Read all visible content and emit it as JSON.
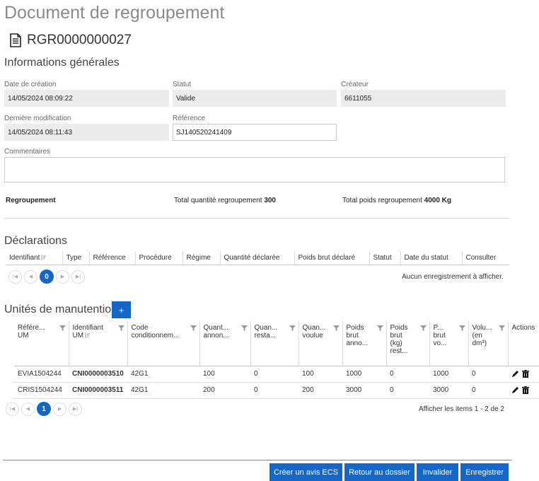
{
  "page": {
    "title": "Document de regroupement",
    "doc_id": "RGR0000000027"
  },
  "general": {
    "section_title": "Informations générales",
    "date_creation_label": "Date de création",
    "date_creation": "14/05/2024 08:09:22",
    "statut_label": "Statut",
    "statut": "Valide",
    "createur_label": "Créateur",
    "createur": "6611055",
    "derniere_modif_label": "Dernière modification",
    "derniere_modif": "14/05/2024 08:11:43",
    "reference_label": "Référence",
    "reference": "SJ140520241409",
    "commentaires_label": "Commentaires",
    "commentaires": ""
  },
  "summary": {
    "regroupement_label": "Regroupement",
    "total_qte_label": "Total quantité regroupement",
    "total_qte": "300",
    "total_poids_label": "Total poids regroupement",
    "total_poids": "4000 Kg"
  },
  "declarations": {
    "section_title": "Déclarations",
    "columns": [
      "Identifiant",
      "Type",
      "Référence",
      "Procédure",
      "Régime",
      "Quantité déclarée",
      "Poids brut déclaré",
      "Statut",
      "Date du statut",
      "Consulter"
    ],
    "page": "0",
    "empty_text": "Aucun enregistrement à afficher."
  },
  "unites": {
    "section_title": "Unités de manutention",
    "add_label": "+",
    "columns": [
      [
        "Référe...",
        "UM"
      ],
      [
        "Identifiant",
        "UM"
      ],
      [
        "Code",
        "conditionnem..."
      ],
      [
        "Quant...",
        "annon..."
      ],
      [
        "Quan...",
        "resta..."
      ],
      [
        "Quan...",
        "voulue"
      ],
      [
        "Poids",
        "brut",
        "anno..."
      ],
      [
        "Poids",
        "brut",
        "(kg)",
        "rest..."
      ],
      [
        "P...",
        "brut",
        "vo..."
      ],
      [
        "Volu...",
        "(en",
        "dm³)"
      ],
      [
        "Actions"
      ]
    ],
    "rows": [
      {
        "ref": "EVIA1504244",
        "ident": "CNI0000003510",
        "code": "42G1",
        "q_annon": "100",
        "q_rest": "0",
        "q_voulue": "100",
        "p_anno": "1000",
        "p_rest": "0",
        "p_voulu": "1000",
        "vol": "0"
      },
      {
        "ref": "CRIS1504244",
        "ident": "CNI0000003511",
        "code": "42G1",
        "q_annon": "200",
        "q_rest": "0",
        "q_voulue": "200",
        "p_anno": "3000",
        "p_rest": "0",
        "p_voulu": "3000",
        "vol": "0"
      }
    ],
    "page": "1",
    "pager_text": "Afficher les items 1 - 2 de 2"
  },
  "buttons": {
    "avis_ecs": "Créer un avis ECS",
    "retour": "Retour au dossier",
    "invalider": "Invalider",
    "enregistrer": "Enregistrer"
  },
  "colors": {
    "accent": "#1466c8",
    "field_bg": "#ececec"
  }
}
